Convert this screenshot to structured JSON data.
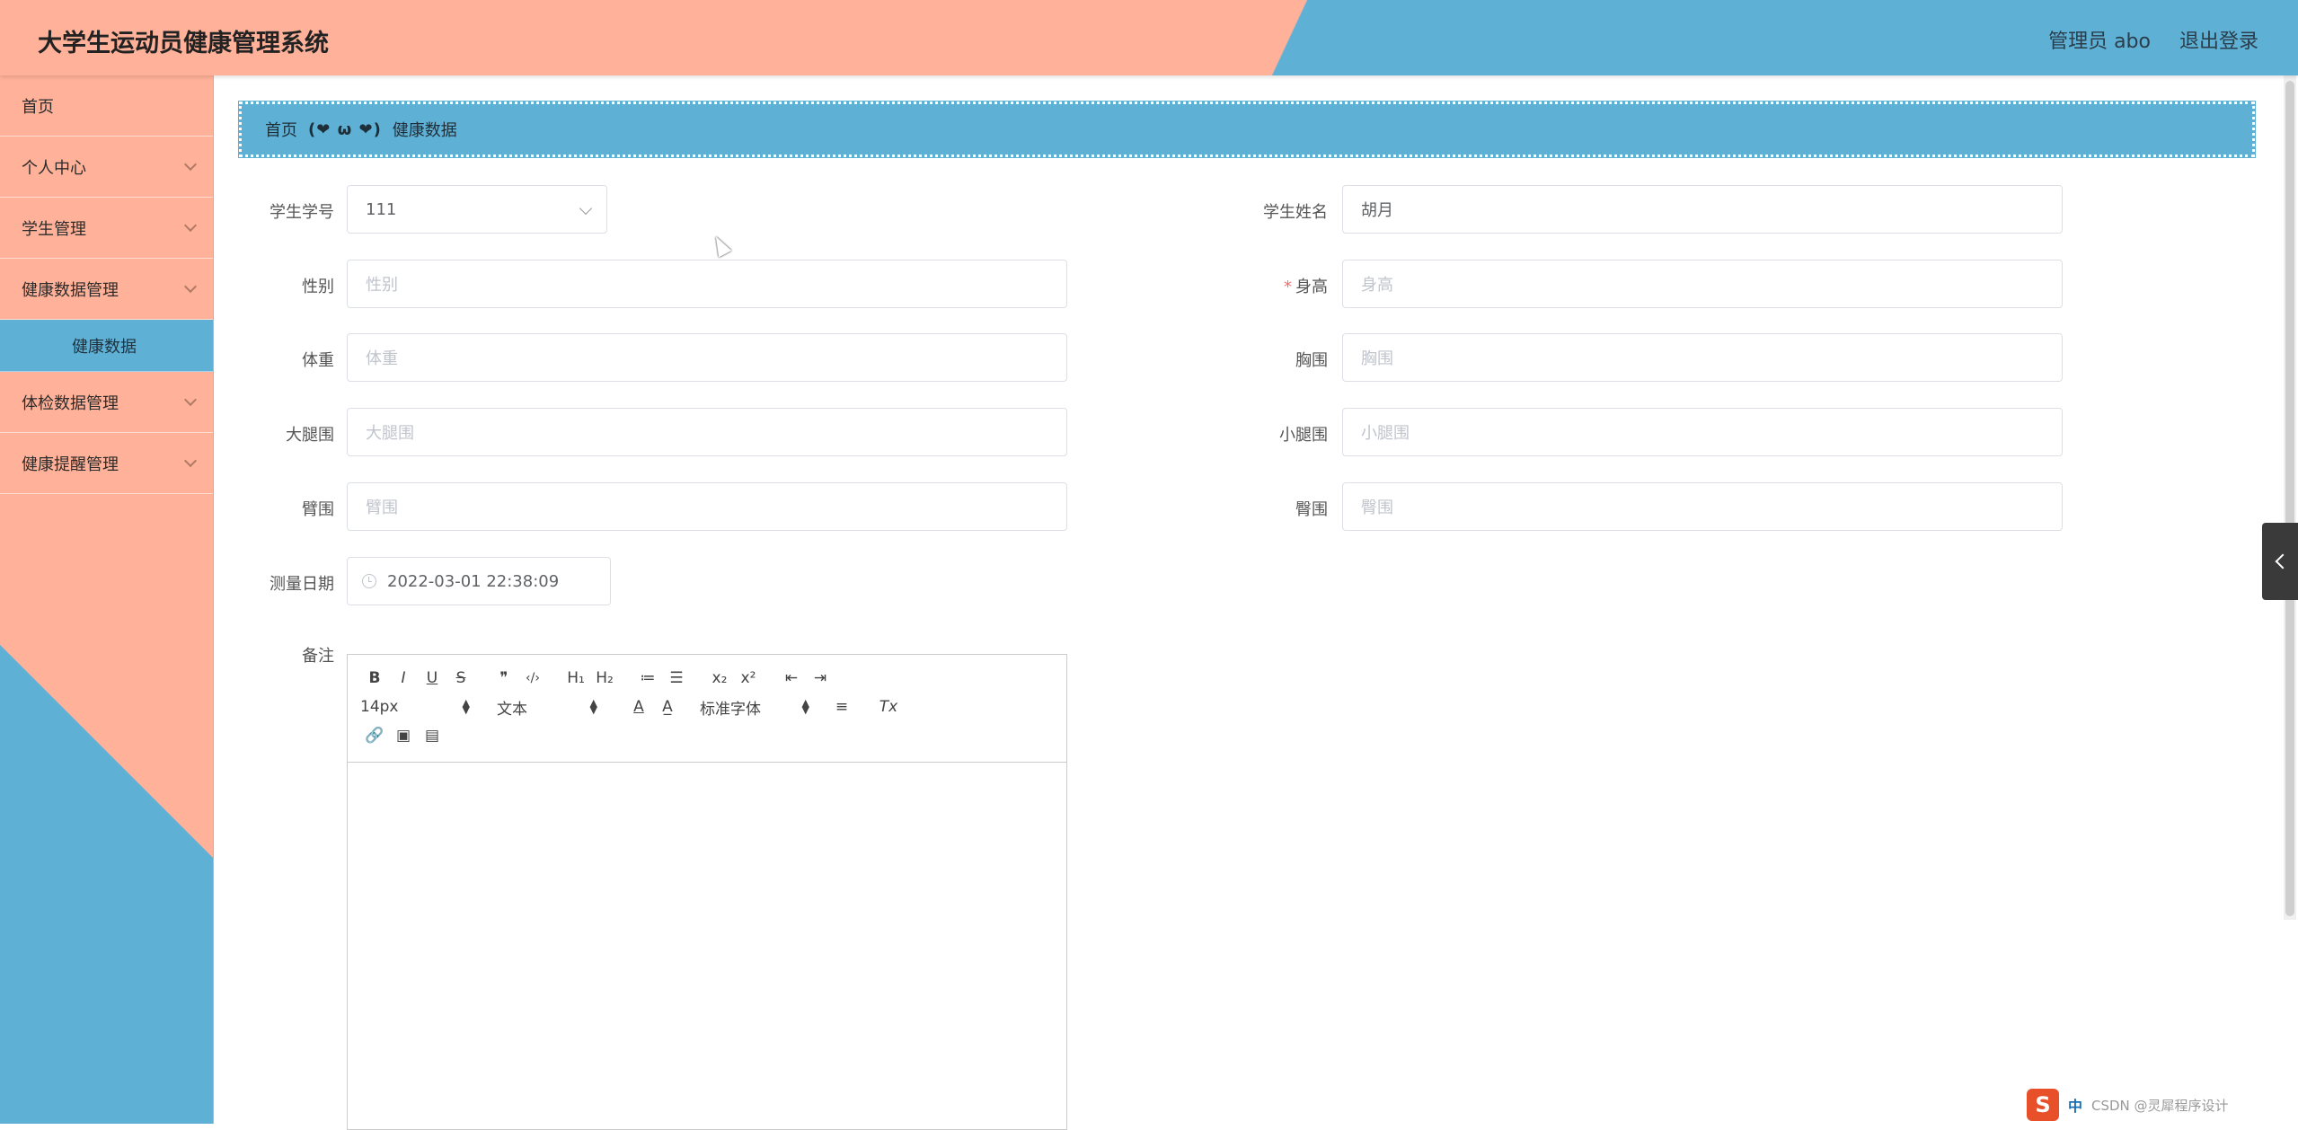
{
  "header": {
    "title": "大学生运动员健康管理系统",
    "user": "管理员 abo",
    "logout": "退出登录"
  },
  "sidebar": {
    "items": [
      {
        "label": "首页",
        "expandable": false
      },
      {
        "label": "个人中心",
        "expandable": true
      },
      {
        "label": "学生管理",
        "expandable": true
      },
      {
        "label": "健康数据管理",
        "expandable": true
      },
      {
        "label": "体检数据管理",
        "expandable": true
      },
      {
        "label": "健康提醒管理",
        "expandable": true
      }
    ],
    "active_sub": "健康数据"
  },
  "breadcrumb": {
    "home": "首页",
    "separator": "(❤ ω ❤)",
    "current": "健康数据"
  },
  "form": {
    "student_id": {
      "label": "学生学号",
      "value": "111"
    },
    "student_name": {
      "label": "学生姓名",
      "value": "胡月"
    },
    "gender": {
      "label": "性别",
      "placeholder": "性别"
    },
    "height": {
      "label": "身高",
      "placeholder": "身高",
      "required": true
    },
    "weight": {
      "label": "体重",
      "placeholder": "体重"
    },
    "chest": {
      "label": "胸围",
      "placeholder": "胸围"
    },
    "thigh": {
      "label": "大腿围",
      "placeholder": "大腿围"
    },
    "calf": {
      "label": "小腿围",
      "placeholder": "小腿围"
    },
    "arm": {
      "label": "臂围",
      "placeholder": "臂围"
    },
    "hip": {
      "label": "臀围",
      "placeholder": "臀围"
    },
    "date": {
      "label": "测量日期",
      "value": "2022-03-01 22:38:09"
    },
    "notes": {
      "label": "备注"
    }
  },
  "editor": {
    "row1": [
      "B",
      "I",
      "U",
      "S",
      "❞",
      "‹/›",
      "H₁",
      "H₂",
      "≔",
      "☰",
      "x₂",
      "x²",
      "⇤",
      "⇥"
    ],
    "font_size": "14px",
    "block_type": "文本",
    "font_family": "标准字体",
    "row2_icons": [
      "A",
      "A̲",
      "≡",
      "Tx"
    ],
    "row3_icons": [
      "🔗",
      "▣",
      "▤"
    ]
  },
  "ime": {
    "logo": "S",
    "mode": "中",
    "watermark": "CSDN @灵犀程序设计"
  },
  "colors": {
    "salmon": "#ffb299",
    "blue": "#5fb0d5"
  }
}
